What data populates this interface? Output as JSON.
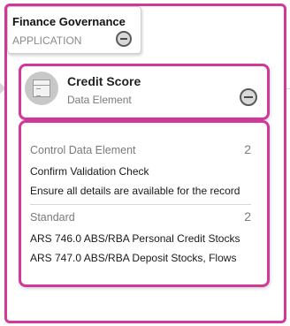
{
  "application": {
    "title": "Finance Governance",
    "type_label": "APPLICATION"
  },
  "element": {
    "title": "Credit Score",
    "type_label": "Data Element"
  },
  "details": {
    "sections": [
      {
        "heading": "Control Data Element",
        "count": "2",
        "items": [
          "Confirm Validation Check",
          "Ensure all details are available for the record"
        ]
      },
      {
        "heading": "Standard",
        "count": "2",
        "items": [
          "ARS 746.0 ABS/RBA Personal Credit Stocks",
          "ARS 747.0 ABS/RBA Deposit Stocks, Flows"
        ]
      }
    ]
  },
  "colors": {
    "accent": "#d1389a"
  },
  "icons": {
    "collapse": "minus-circle-icon",
    "data_element": "data-element-icon"
  }
}
